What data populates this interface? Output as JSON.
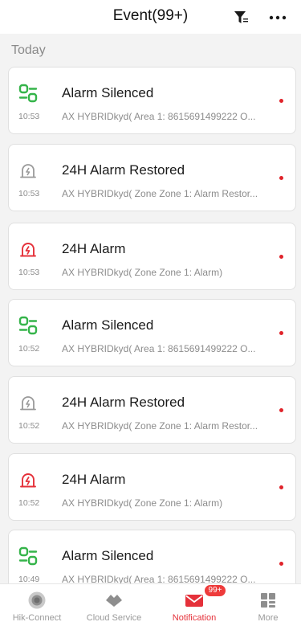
{
  "header": {
    "title": "Event(99+)"
  },
  "section": {
    "label": "Today"
  },
  "events": [
    {
      "icon": "alarm-silenced-icon",
      "title": "Alarm Silenced",
      "time": "10:53",
      "description": "AX HYBRIDkyd( Area 1: 8615691499222 O..."
    },
    {
      "icon": "alarm-restored-icon",
      "title": "24H Alarm Restored",
      "time": "10:53",
      "description": "AX HYBRIDkyd( Zone Zone 1: Alarm Restor..."
    },
    {
      "icon": "alarm-icon",
      "title": "24H Alarm",
      "time": "10:53",
      "description": "AX HYBRIDkyd( Zone Zone 1: Alarm)"
    },
    {
      "icon": "alarm-silenced-icon",
      "title": "Alarm Silenced",
      "time": "10:52",
      "description": "AX HYBRIDkyd( Area 1: 8615691499222 O..."
    },
    {
      "icon": "alarm-restored-icon",
      "title": "24H Alarm Restored",
      "time": "10:52",
      "description": "AX HYBRIDkyd( Zone Zone 1: Alarm Restor..."
    },
    {
      "icon": "alarm-icon",
      "title": "24H Alarm",
      "time": "10:52",
      "description": "AX HYBRIDkyd( Zone Zone 1: Alarm)"
    },
    {
      "icon": "alarm-silenced-icon",
      "title": "Alarm Silenced",
      "time": "10:49",
      "description": "AX HYBRIDkyd( Area 1: 8615691499222 O..."
    }
  ],
  "tabbar": {
    "tabs": [
      {
        "label": "Hik-Connect",
        "icon": "hik-connect-icon"
      },
      {
        "label": "Cloud Service",
        "icon": "cloud-service-icon"
      },
      {
        "label": "Notification",
        "icon": "mail-icon",
        "badge": "99+"
      },
      {
        "label": "More",
        "icon": "more-grid-icon"
      }
    ]
  },
  "colors": {
    "accent": "#e5313a",
    "silenced": "#35b44a",
    "alarm": "#e5313a",
    "restored": "#9a9a9a",
    "unread_dot": "#e0232a"
  }
}
